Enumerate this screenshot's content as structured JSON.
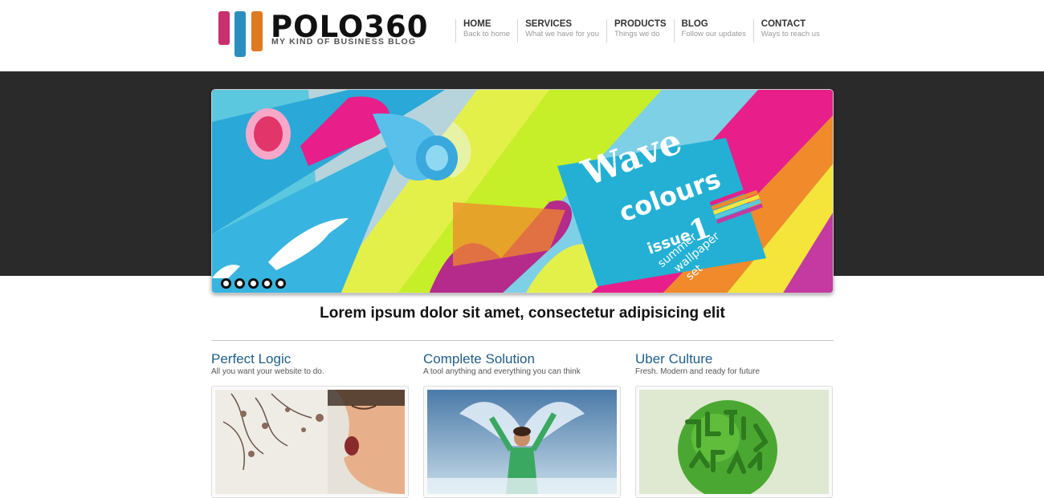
{
  "brand": {
    "title": "POLO360",
    "tagline": "MY KIND OF BUSINESS BLOG",
    "colors": {
      "pink": "#c8306f",
      "blue": "#2a8fbf",
      "orange": "#e07a20"
    }
  },
  "nav": [
    {
      "label": "HOME",
      "sub": "Back to home"
    },
    {
      "label": "SERVICES",
      "sub": "What we have for you"
    },
    {
      "label": "PRODUCTS",
      "sub": "Things we do"
    },
    {
      "label": "BLOG",
      "sub": "Follow our updates"
    },
    {
      "label": "CONTACT",
      "sub": "Ways to reach us"
    }
  ],
  "slider": {
    "image_text": {
      "word1": "Wave",
      "word2": "colours",
      "issue": "issue",
      "issue_num": "1",
      "line1": "summer",
      "line2": "wallpaper",
      "line3": "set"
    },
    "dots": 5
  },
  "main": {
    "tagline": "Lorem ipsum dolor sit amet, consectetur adipisicing elit"
  },
  "columns": [
    {
      "title": "Perfect Logic",
      "sub": "All you want your website to do."
    },
    {
      "title": "Complete Solution",
      "sub": "A tool anything and everything you can think"
    },
    {
      "title": "Uber Culture",
      "sub": "Fresh. Modern and ready for future"
    }
  ]
}
